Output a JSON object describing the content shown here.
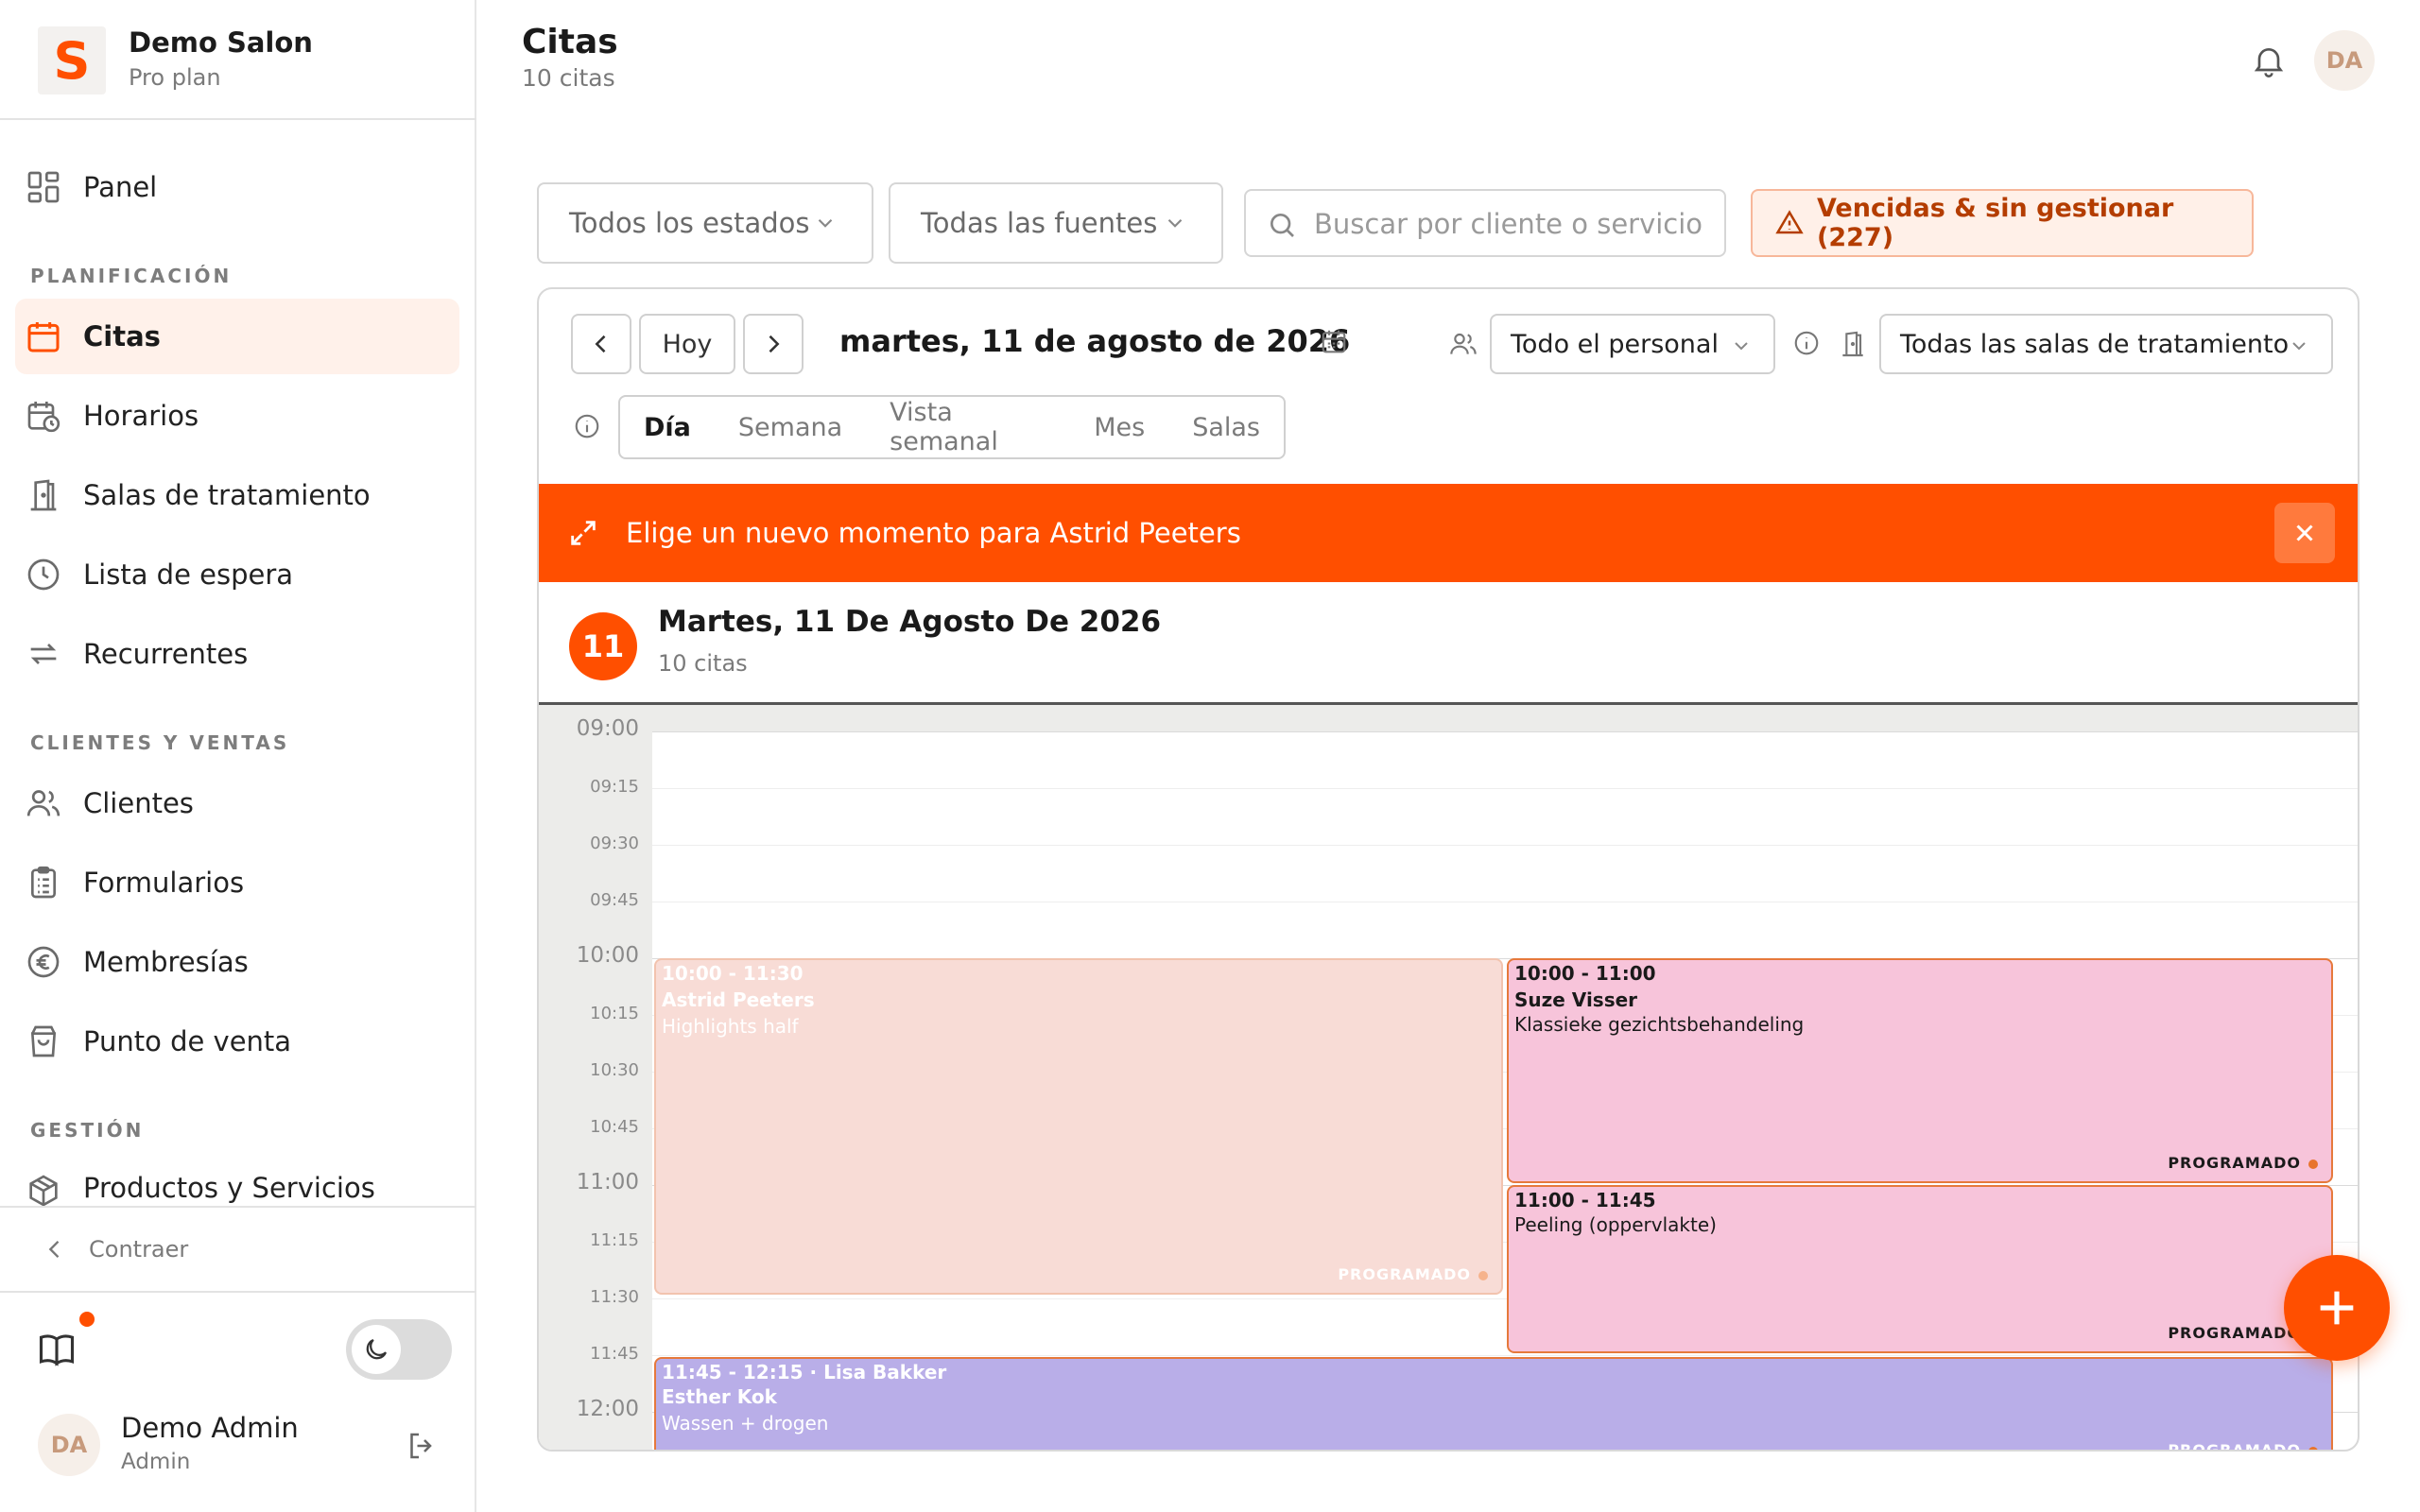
{
  "sidebar": {
    "brand": {
      "logo_letter": "S",
      "name": "Demo Salon",
      "plan": "Pro plan"
    },
    "panel_label": "Panel",
    "sections": {
      "planning": "PLANIFICACIÓN",
      "clients_sales": "CLIENTES Y VENTAS",
      "management": "GESTIÓN"
    },
    "items": {
      "citas": "Citas",
      "horarios": "Horarios",
      "salas": "Salas de tratamiento",
      "espera": "Lista de espera",
      "recurrentes": "Recurrentes",
      "clientes": "Clientes",
      "formularios": "Formularios",
      "membresias": "Membresías",
      "punto_venta": "Punto de venta",
      "productos": "Productos y Servicios"
    },
    "collapse_label": "Contraer",
    "user": {
      "initials": "DA",
      "name": "Demo Admin",
      "role": "Admin"
    }
  },
  "header": {
    "title": "Citas",
    "subtitle": "10 citas",
    "avatar_initials": "DA"
  },
  "filters": {
    "status": "Todos los estados",
    "source": "Todas las fuentes",
    "search_placeholder": "Buscar por cliente o servicio",
    "overdue_label": "Vencidas & sin gestionar (227)"
  },
  "calendar": {
    "today_label": "Hoy",
    "date_title": "martes, 11 de agosto de 2026",
    "staff_select": "Todo el personal",
    "room_select": "Todas las salas de tratamiento",
    "views": [
      "Día",
      "Semana",
      "Vista semanal",
      "Mes",
      "Salas"
    ],
    "active_view": "Día",
    "banner_text": "Elige un nuevo momento para Astrid Peeters",
    "day_number": "11",
    "day_title": "Martes, 11 De Agosto De 2026",
    "day_count": "10 citas",
    "time_labels": [
      "09:00",
      "09:15",
      "09:30",
      "09:45",
      "10:00",
      "10:15",
      "10:30",
      "10:45",
      "11:00",
      "11:15",
      "11:30",
      "11:45",
      "12:00"
    ],
    "appointments": [
      {
        "time": "10:00 - 11:30",
        "client": "Astrid Peeters",
        "service": "Highlights half",
        "status": "PROGRAMADO",
        "start": "10:00",
        "end": "11:30"
      },
      {
        "time": "10:00 - 11:00",
        "client": "Suze Visser",
        "service": "Klassieke gezichtsbehandeling",
        "status": "PROGRAMADO",
        "start": "10:00",
        "end": "11:00"
      },
      {
        "time": "11:00 - 11:45",
        "client": "",
        "service": "Peeling (oppervlakte)",
        "status": "PROGRAMADO",
        "start": "11:00",
        "end": "11:45"
      },
      {
        "time": "11:45 - 12:15 · Lisa Bakker",
        "client": "Esther Kok",
        "service": "Wassen + drogen",
        "status": "PROGRAMADO",
        "start": "11:45",
        "end": "12:15"
      }
    ]
  },
  "colors": {
    "accent": "#ff4f00",
    "ghost_appointment": "#f8dcd6",
    "pink_appointment": "#f7c4da",
    "purple_appointment": "#b9aee8"
  }
}
